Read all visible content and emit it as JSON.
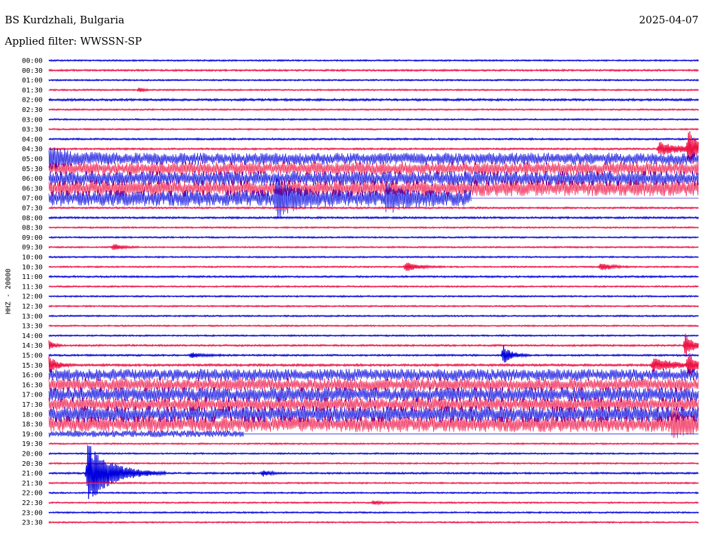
{
  "header": {
    "station": "BS Kurdzhali, Bulgaria",
    "date": "2025-04-07",
    "filter": "Applied filter: WWSSN-SP"
  },
  "chart_data": {
    "type": "line",
    "ylabel": "HHZ - 20000",
    "colors": [
      "#0000dd",
      "#ee1144"
    ],
    "rows": [
      {
        "time": "00:00",
        "noise": 1.0
      },
      {
        "time": "00:30",
        "noise": 1.2
      },
      {
        "time": "01:00",
        "noise": 1.0
      },
      {
        "time": "01:30",
        "noise": 1.0,
        "events": [
          {
            "x": 0.14,
            "amp": 4,
            "dur": 0.01
          }
        ]
      },
      {
        "time": "02:00",
        "noise": 1.5
      },
      {
        "time": "02:30",
        "noise": 1.0
      },
      {
        "time": "03:00",
        "noise": 1.0
      },
      {
        "time": "03:30",
        "noise": 1.0
      },
      {
        "time": "04:00",
        "noise": 1.2
      },
      {
        "time": "04:30",
        "noise": 1.2,
        "events": [
          {
            "x": 0.94,
            "amp": 10,
            "dur": 0.06
          },
          {
            "x": 0.985,
            "amp": 30,
            "dur": 0.02
          }
        ]
      },
      {
        "time": "05:00",
        "noise": 9,
        "events": [
          {
            "x": 0.0,
            "amp": 14,
            "dur": 0.05
          }
        ]
      },
      {
        "time": "05:30",
        "noise": 10
      },
      {
        "time": "06:00",
        "noise": 11
      },
      {
        "time": "06:30",
        "noise": 12
      },
      {
        "time": "07:00",
        "noise": 12,
        "end": 0.65,
        "events": [
          {
            "x": 0.35,
            "amp": 25,
            "dur": 0.05
          },
          {
            "x": 0.52,
            "amp": 15,
            "dur": 0.04
          }
        ]
      },
      {
        "time": "07:30",
        "noise": 1.2
      },
      {
        "time": "08:00",
        "noise": 1.3
      },
      {
        "time": "08:30",
        "noise": 1.0
      },
      {
        "time": "09:00",
        "noise": 1.0
      },
      {
        "time": "09:30",
        "noise": 1.0,
        "events": [
          {
            "x": 0.1,
            "amp": 6,
            "dur": 0.02
          }
        ]
      },
      {
        "time": "10:00",
        "noise": 1.0
      },
      {
        "time": "10:30",
        "noise": 1.0,
        "events": [
          {
            "x": 0.55,
            "amp": 7,
            "dur": 0.03
          },
          {
            "x": 0.85,
            "amp": 6,
            "dur": 0.025
          }
        ]
      },
      {
        "time": "11:00",
        "noise": 1.2
      },
      {
        "time": "11:30",
        "noise": 1.0
      },
      {
        "time": "12:00",
        "noise": 1.0
      },
      {
        "time": "12:30",
        "noise": 1.0
      },
      {
        "time": "13:00",
        "noise": 1.0
      },
      {
        "time": "13:30",
        "noise": 1.0
      },
      {
        "time": "14:00",
        "noise": 1.0
      },
      {
        "time": "14:30",
        "noise": 1.2,
        "events": [
          {
            "x": 0.0,
            "amp": 10,
            "dur": 0.01
          },
          {
            "x": 0.98,
            "amp": 18,
            "dur": 0.02
          }
        ]
      },
      {
        "time": "15:00",
        "noise": 1.2,
        "events": [
          {
            "x": 0.22,
            "amp": 4,
            "dur": 0.03
          },
          {
            "x": 0.7,
            "amp": 14,
            "dur": 0.02
          }
        ]
      },
      {
        "time": "15:30",
        "noise": 1.5,
        "events": [
          {
            "x": 0.0,
            "amp": 14,
            "dur": 0.02
          },
          {
            "x": 0.93,
            "amp": 10,
            "dur": 0.06
          },
          {
            "x": 0.985,
            "amp": 20,
            "dur": 0.015
          }
        ]
      },
      {
        "time": "16:00",
        "noise": 9
      },
      {
        "time": "16:30",
        "noise": 10
      },
      {
        "time": "17:00",
        "noise": 11
      },
      {
        "time": "17:30",
        "noise": 11
      },
      {
        "time": "18:00",
        "noise": 12
      },
      {
        "time": "18:30",
        "noise": 12,
        "events": [
          {
            "x": 0.96,
            "amp": 20,
            "dur": 0.04
          }
        ]
      },
      {
        "time": "19:00",
        "noise": 5,
        "end": 0.3
      },
      {
        "time": "19:30",
        "noise": 1.0
      },
      {
        "time": "20:00",
        "noise": 1.0
      },
      {
        "time": "20:30",
        "noise": 1.0
      },
      {
        "time": "21:00",
        "noise": 1.2,
        "events": [
          {
            "x": 0.06,
            "amp": 45,
            "dur": 0.06
          },
          {
            "x": 0.33,
            "amp": 4,
            "dur": 0.02
          }
        ]
      },
      {
        "time": "21:30",
        "noise": 1.0
      },
      {
        "time": "22:00",
        "noise": 1.0
      },
      {
        "time": "22:30",
        "noise": 1.0,
        "events": [
          {
            "x": 0.5,
            "amp": 3,
            "dur": 0.02
          }
        ]
      },
      {
        "time": "23:00",
        "noise": 1.0
      },
      {
        "time": "23:30",
        "noise": 1.0
      }
    ]
  }
}
